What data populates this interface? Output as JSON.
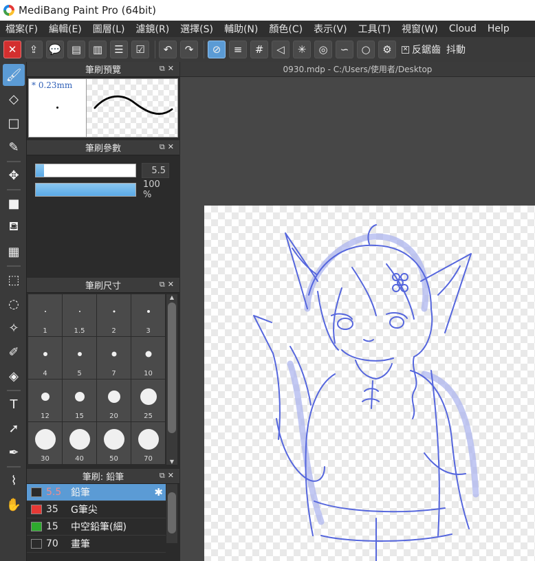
{
  "window": {
    "title": "MediBang Paint Pro (64bit)"
  },
  "menu": [
    "檔案(F)",
    "編輯(E)",
    "圖層(L)",
    "濾鏡(R)",
    "選擇(S)",
    "輔助(N)",
    "顏色(C)",
    "表示(V)",
    "工具(T)",
    "視窗(W)",
    "Cloud",
    "Help"
  ],
  "toolbar": {
    "antialias_label": "反鋸齒",
    "stabilizer_label": "抖動"
  },
  "panels": {
    "preview": {
      "title": "筆刷預覽",
      "size_text": "* 0.23mm"
    },
    "params": {
      "title": "筆刷參數",
      "size_value": "5.5",
      "opacity_value": "100 %",
      "size_fraction": 0.08,
      "opacity_fraction": 1.0
    },
    "sizes": {
      "title": "筆刷尺寸",
      "items": [
        "1",
        "1.5",
        "2",
        "3",
        "4",
        "5",
        "7",
        "10",
        "12",
        "15",
        "20",
        "25",
        "30",
        "40",
        "50",
        "70"
      ]
    },
    "brushes": {
      "title": "筆刷: 鉛筆",
      "items": [
        {
          "size": "5.5",
          "name": "鉛筆",
          "color": "#2b2b2b",
          "active": true
        },
        {
          "size": "35",
          "name": "G筆尖",
          "color": "#e53935",
          "active": false
        },
        {
          "size": "15",
          "name": "中空鉛筆(細)",
          "color": "#2eaa2e",
          "active": false
        },
        {
          "size": "70",
          "name": "畫筆",
          "color": "#2b2b2b",
          "active": false
        }
      ]
    }
  },
  "document": {
    "tab_title": "0930.mdp - C:/Users/使用者/Desktop"
  },
  "colors": {
    "accent": "#5b9bd5",
    "sketch": "#5566dd"
  }
}
